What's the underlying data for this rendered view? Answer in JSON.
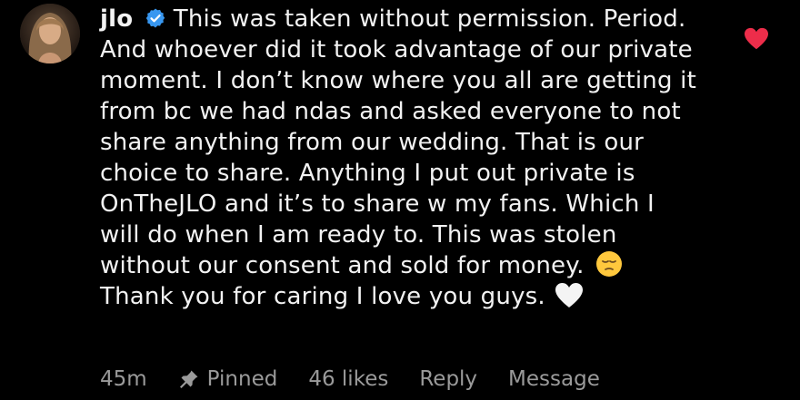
{
  "comment": {
    "username": "jlo",
    "verified": true,
    "text_part1": "This was taken without permission. Period. And whoever did it took advantage of our private moment. I don’t know where you all are getting it from bc we had ndas and asked everyone to not share anything from our wedding. That is our choice to share. Anything I put out private is OnTheJLO and it’s to share w my fans. Which I will do when I am ready to. This was stolen without our consent and sold for money.",
    "emoji_1": "pensive-face",
    "text_part2": "Thank you for caring I love you guys.",
    "emoji_2": "white-heart",
    "liked": true
  },
  "meta": {
    "time": "45m",
    "pinned_label": "Pinned",
    "likes": "46 likes",
    "reply_label": "Reply",
    "message_label": "Message"
  },
  "colors": {
    "background": "#000000",
    "text": "#f2f2f2",
    "muted": "#9a9a9a",
    "verified_blue": "#3897f0",
    "like_red": "#ed2d4a"
  },
  "icons": {
    "avatar": "profile-photo",
    "verified": "verified-badge-icon",
    "like": "heart-icon",
    "pin": "pin-icon"
  }
}
